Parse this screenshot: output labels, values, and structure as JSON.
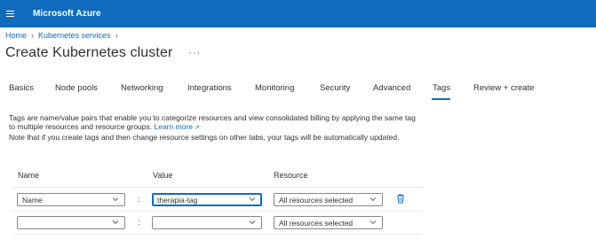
{
  "topbar": {
    "brand": "Microsoft Azure",
    "menu_icon": "hamburger-icon"
  },
  "breadcrumb": {
    "items": [
      "Home",
      "Kubernetes services"
    ]
  },
  "page": {
    "title": "Create Kubernetes cluster",
    "more": "···"
  },
  "tabs": [
    {
      "label": "Basics"
    },
    {
      "label": "Node pools"
    },
    {
      "label": "Networking"
    },
    {
      "label": "Integrations"
    },
    {
      "label": "Monitoring"
    },
    {
      "label": "Security"
    },
    {
      "label": "Advanced"
    },
    {
      "label": "Tags",
      "active": true
    },
    {
      "label": "Review + create"
    }
  ],
  "description": {
    "line1": "Tags are name/value pairs that enable you to categorize resources and view consolidated billing by applying the same tag",
    "line2": "to multiple resources and resource groups.",
    "learn_more": "Learn more",
    "line3": "Note that if you create tags and then change resource settings on other tabs, your tags will be automatically updated."
  },
  "columns": {
    "name": "Name",
    "value": "Value",
    "resource": "Resource"
  },
  "rows": [
    {
      "name": "Name",
      "value": "therapia-tag",
      "resource": "All resources selected",
      "delete_icon": "trash-icon"
    },
    {
      "name": "",
      "value": "",
      "resource": "All resources selected"
    }
  ],
  "colors": {
    "accent": "#0f6cbd",
    "topbar": "#0f6cbd"
  }
}
